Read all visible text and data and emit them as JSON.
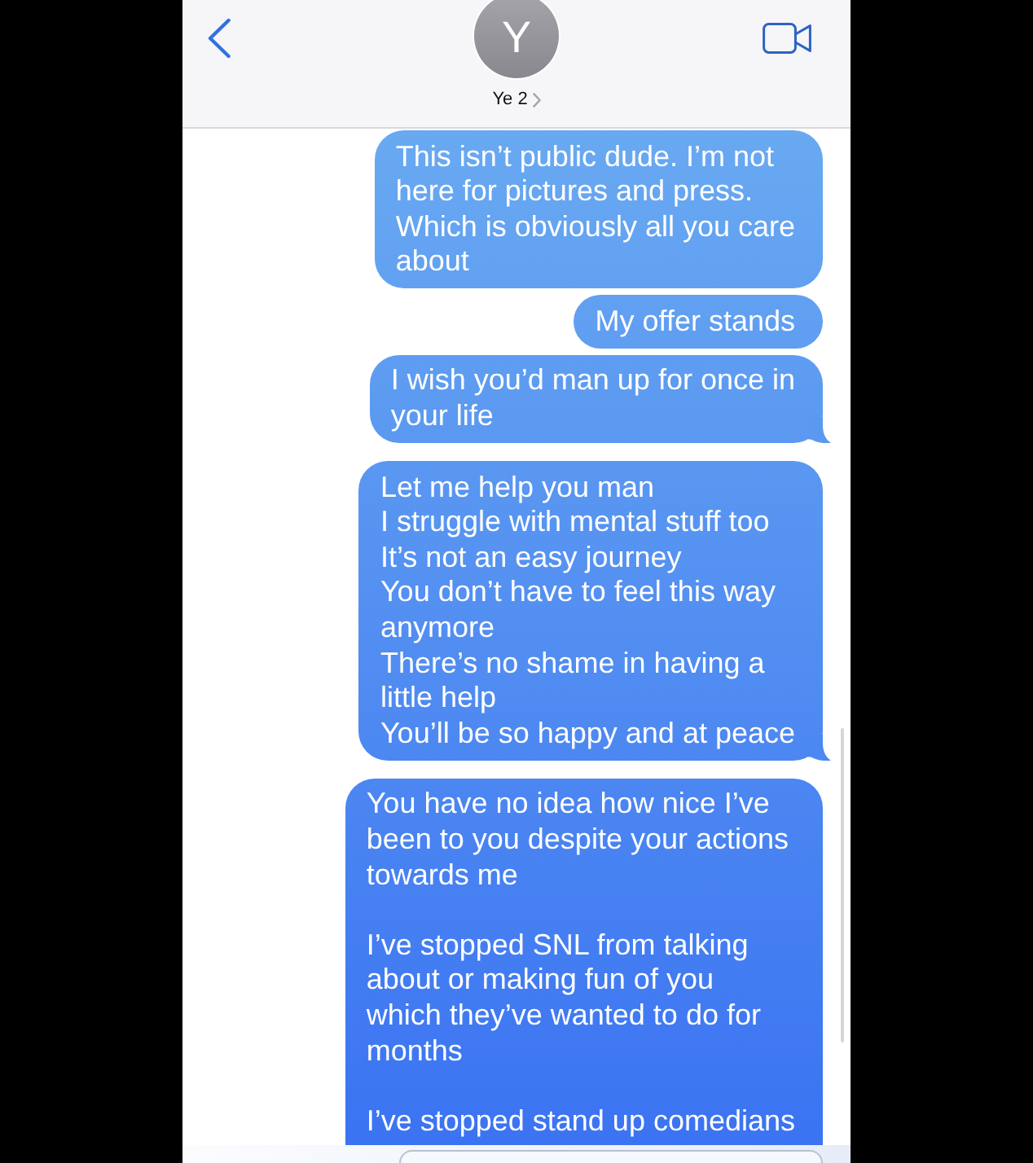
{
  "header": {
    "contact": {
      "initial": "Y",
      "name": "Ye 2"
    }
  },
  "messages": [
    {
      "text": "This isn’t public dude. I’m not\nhere for pictures and press.\nWhich is obviously all you care\nabout",
      "tail": false
    },
    {
      "text": "My offer stands",
      "tail": false
    },
    {
      "text": "I wish you’d man up for once in\nyour life",
      "tail": true
    },
    {
      "text": "Let me help you man\nI struggle with mental stuff too\nIt’s not an easy journey\nYou don’t have to feel this way\nanymore\nThere’s no shame in having a\nlittle help\nYou’ll be so happy and at peace",
      "tail": true
    },
    {
      "text": "You have no idea how nice I’ve\nbeen to you despite your actions\ntowards me\n\nI’ve stopped SNL from talking\nabout or making fun of you\nwhich they’ve wanted to do for\nmonths\n\nI’ve stopped stand up comedians",
      "tail": false
    }
  ]
}
